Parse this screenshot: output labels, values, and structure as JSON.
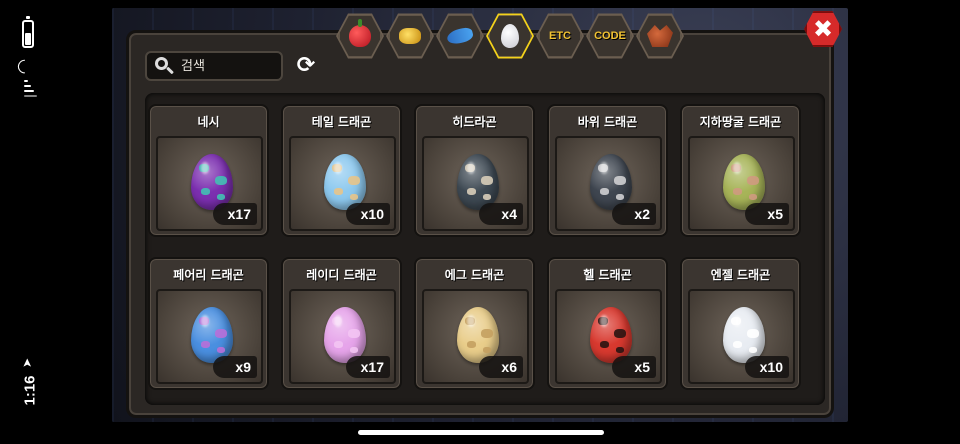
{
  "status": {
    "time": "1:16"
  },
  "search": {
    "placeholder": "검색"
  },
  "tabs": [
    {
      "icon": "fruit-icon",
      "label": ""
    },
    {
      "icon": "gold-icon",
      "label": ""
    },
    {
      "icon": "fish-icon",
      "label": ""
    },
    {
      "icon": "egg-icon",
      "label": "",
      "active": true
    },
    {
      "icon": "etc-label",
      "label": "ETC"
    },
    {
      "icon": "code-label",
      "label": "CODE"
    },
    {
      "icon": "dragon-icon",
      "label": ""
    }
  ],
  "eggs": [
    {
      "name": "네시",
      "count": "x17",
      "color": "#7c2fb0",
      "spot": "#43c0b4"
    },
    {
      "name": "테일 드래곤",
      "count": "x10",
      "color": "#8dc9ef",
      "spot": "#e7c48a"
    },
    {
      "name": "히드라곤",
      "count": "x4",
      "color": "#3e4953",
      "spot": "#d8cdb9"
    },
    {
      "name": "바위 드래곤",
      "count": "x2",
      "color": "#3f4650",
      "spot": "#cfcfd2"
    },
    {
      "name": "지하땅굴 드래곤",
      "count": "x5",
      "color": "#a7b458",
      "spot": "#cf9a7f"
    },
    {
      "name": "페어리 드래곤",
      "count": "x9",
      "color": "#4a8fe0",
      "spot": "#b86fd8"
    },
    {
      "name": "레이디 드래곤",
      "count": "x17",
      "color": "#e6a4ea",
      "spot": "#f3c4f3"
    },
    {
      "name": "에그 드래곤",
      "count": "x6",
      "color": "#e9cd8a",
      "spot": "#c4a061"
    },
    {
      "name": "헬 드래곤",
      "count": "x5",
      "color": "#d8392f",
      "spot": "#2a1412"
    },
    {
      "name": "엔젤 드래곤",
      "count": "x10",
      "color": "#e8ecf2",
      "spot": "#ffffff"
    }
  ]
}
